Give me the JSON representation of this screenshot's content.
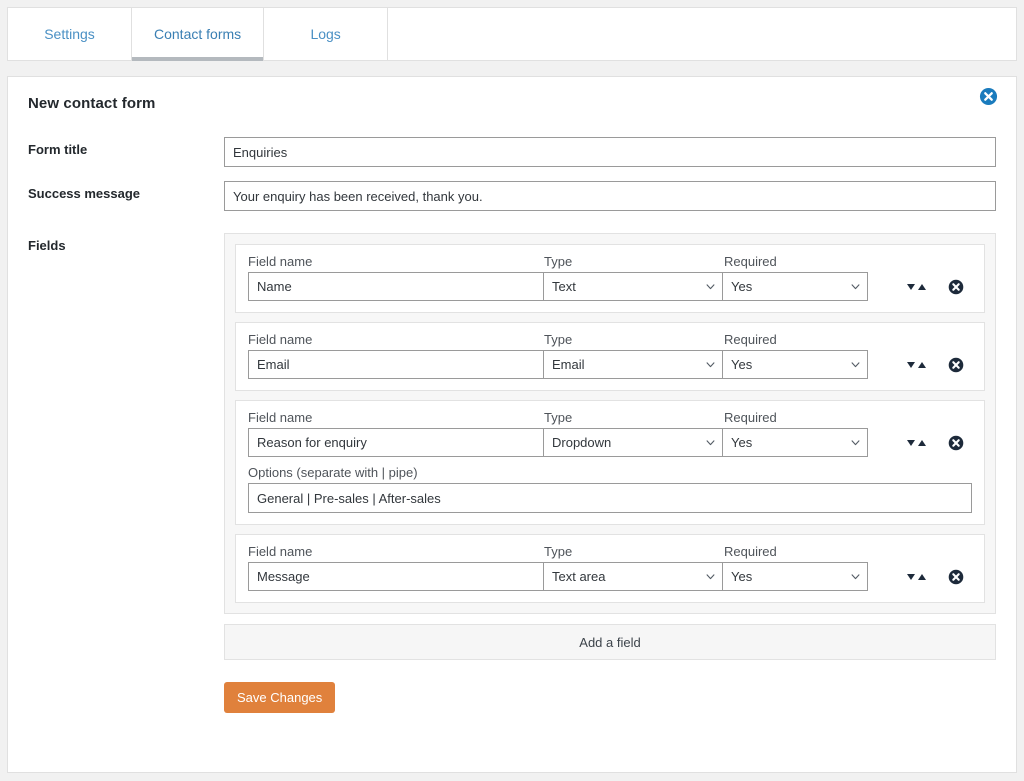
{
  "tabs": [
    {
      "label": "Settings",
      "active": false
    },
    {
      "label": "Contact forms",
      "active": true
    },
    {
      "label": "Logs",
      "active": false
    }
  ],
  "panel": {
    "title": "New contact form",
    "close_icon": "close-circle-icon"
  },
  "form": {
    "title_label": "Form title",
    "title_value": "Enquiries",
    "title_placeholder": "Form title",
    "success_label": "Success message",
    "success_value": "Your enquiry has been received, thank you.",
    "success_placeholder": "Success message",
    "fields_label": "Fields"
  },
  "column_labels": {
    "name": "Field name",
    "type": "Type",
    "required": "Required"
  },
  "options_label": "Options (separate with | pipe)",
  "fields": [
    {
      "name": "Name",
      "name_placeholder": "Field name",
      "type": "Text",
      "required": "Yes",
      "has_options": false,
      "options": ""
    },
    {
      "name": "Email",
      "name_placeholder": "Field name",
      "type": "Email",
      "required": "Yes",
      "has_options": false,
      "options": ""
    },
    {
      "name": "Reason for enquiry",
      "name_placeholder": "Field name",
      "type": "Dropdown",
      "required": "Yes",
      "has_options": true,
      "options": "General | Pre-sales | After-sales",
      "options_placeholder": "General | Pre-sales | After-sales"
    },
    {
      "name": "Message",
      "name_placeholder": "Field name",
      "type": "Text area",
      "required": "Yes",
      "has_options": false,
      "options": ""
    }
  ],
  "buttons": {
    "add_field": "Add a field",
    "save": "Save Changes"
  },
  "icons": {
    "sort": "sort-updown-icon",
    "delete": "delete-circle-icon",
    "chevron": "chevron-down-icon"
  },
  "colors": {
    "page_bg": "#f1f1f1",
    "panel_bg": "#ffffff",
    "tab_link": "#4a90c4",
    "accent_save": "#e0813c",
    "close_blue": "#1a7bbd",
    "delete_dark": "#1d2a3a",
    "border": "#e0e0e0"
  }
}
